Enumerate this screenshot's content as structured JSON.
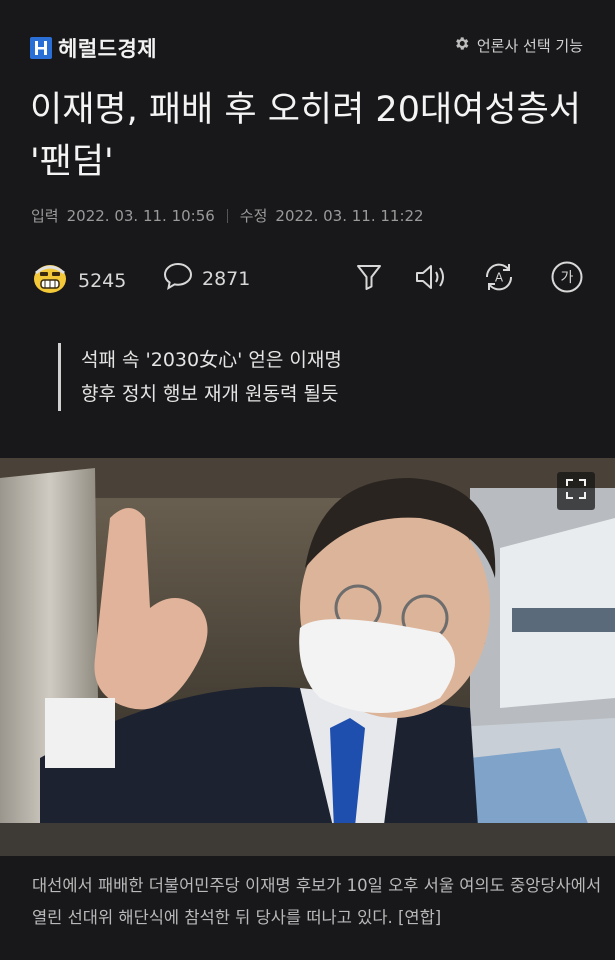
{
  "header": {
    "logo_text": "헤럴드경제",
    "logo_mark": "H",
    "press_select_label": "언론사 선택 기능",
    "press_select_icon": "gear-icon"
  },
  "article": {
    "title": "이재명, 패배 후 오히려 20대여성층서 '팬덤'",
    "published_label": "입력",
    "published_date": "2022. 03. 11. 10:56",
    "modified_label": "수정",
    "modified_date": "2022. 03. 11. 11:22",
    "summary_line1": "석패 속 '2030女心' 얻은 이재명",
    "summary_line2": "향후 정치 행보 재개 원동력 될듯",
    "caption": "대선에서 패배한 더불어민주당 이재명 후보가 10일 오후 서울 여의도 중앙당사에서 열린 선대위 해단식에 참석한 뒤 당사를 떠나고 있다. [연합]"
  },
  "toolbar": {
    "reaction_count": "5245",
    "reaction_icon": "smiley-reaction-icon",
    "comment_count": "2871",
    "comment_icon": "comment-bubble-icon",
    "icons": [
      "summary-funnel-icon",
      "speaker-icon",
      "translate-icon",
      "font-size-icon"
    ],
    "font_size_glyph": "가",
    "translate_glyph": "A"
  },
  "colors": {
    "background": "#18181a",
    "logo_blue": "#2a6fd6",
    "text": "#f4f4f4",
    "muted": "#9a9a9a"
  }
}
